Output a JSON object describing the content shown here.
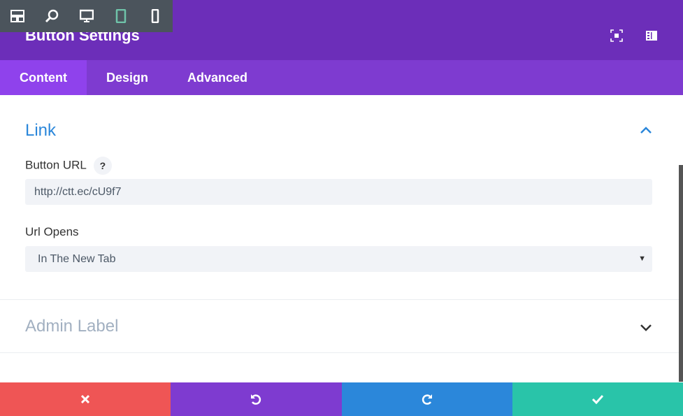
{
  "header": {
    "title": "Button Settings"
  },
  "toolbar": {
    "icons": [
      "layout-icon",
      "zoom-icon",
      "desktop-icon",
      "tablet-icon",
      "phone-icon"
    ],
    "active": "tablet-icon"
  },
  "tabs": [
    {
      "label": "Content",
      "active": true
    },
    {
      "label": "Design"
    },
    {
      "label": "Advanced"
    }
  ],
  "link": {
    "title": "Link",
    "button_url_label": "Button URL",
    "help": "?",
    "button_url_value": "http://ctt.ec/cU9f7",
    "url_opens_label": "Url Opens",
    "url_opens_value": "In The New Tab"
  },
  "admin": {
    "title": "Admin Label"
  },
  "colors": {
    "header": "#6c2eb9",
    "tabs": "#7e3bd0",
    "cancel": "#ef5555",
    "undo": "#7e3bd0",
    "redo": "#2b87da",
    "save": "#29c4a9",
    "accent": "#2b87da"
  }
}
